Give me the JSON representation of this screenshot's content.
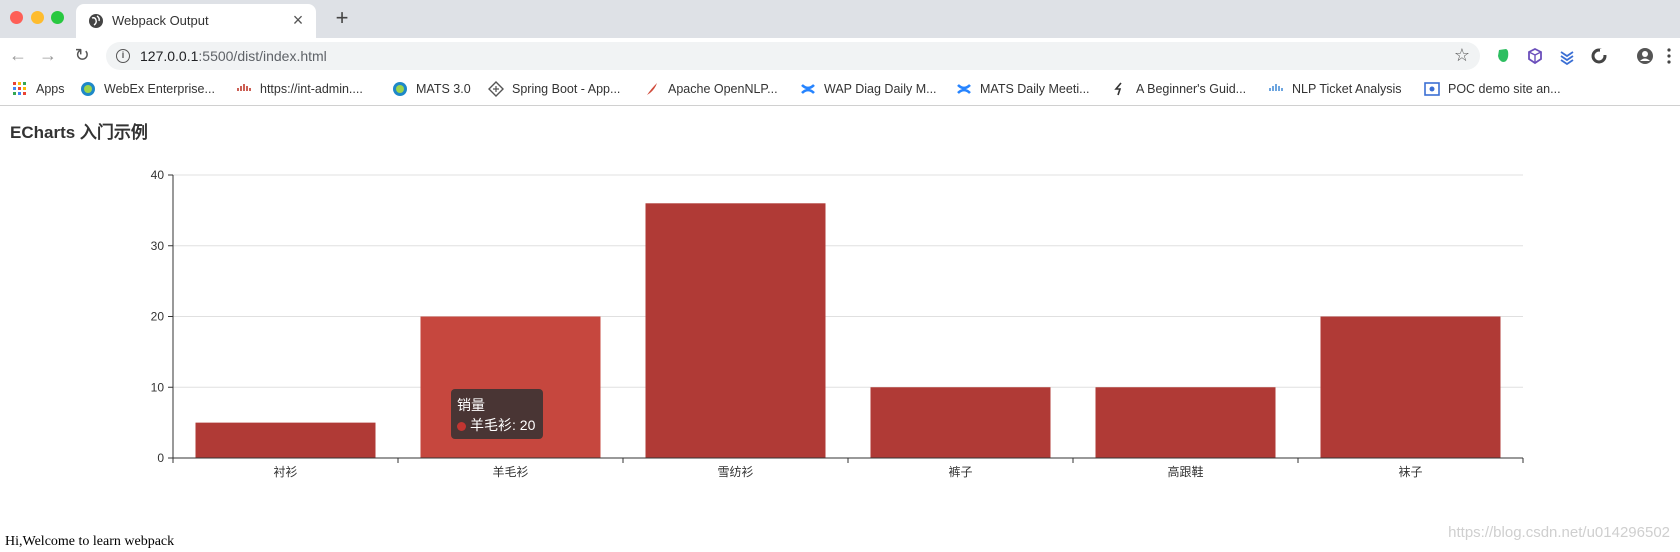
{
  "browser": {
    "tab_title": "Webpack Output",
    "close_glyph": "×",
    "new_tab_glyph": "+",
    "url_host": "127.0.0.1",
    "url_rest": ":5500/dist/index.html",
    "star_glyph": "☆",
    "back_glyph": "←",
    "forward_glyph": "→",
    "reload_glyph": "↻"
  },
  "bookmarks": [
    {
      "label": "Apps",
      "icon": "apps-grid-icon"
    },
    {
      "label": "WebEx Enterprise...",
      "icon": "webex-icon"
    },
    {
      "label": "https://int-admin....",
      "icon": "cisco-icon"
    },
    {
      "label": "MATS 3.0",
      "icon": "mats-icon"
    },
    {
      "label": "Spring Boot - App...",
      "icon": "spring-icon"
    },
    {
      "label": "Apache OpenNLP...",
      "icon": "apache-feather-icon"
    },
    {
      "label": "WAP Diag Daily M...",
      "icon": "confluence-icon"
    },
    {
      "label": "MATS Daily Meeti...",
      "icon": "confluence-icon"
    },
    {
      "label": "A Beginner's Guid...",
      "icon": "link-icon"
    },
    {
      "label": "NLP Ticket Analysis",
      "icon": "cisco-icon"
    },
    {
      "label": "POC demo site an...",
      "icon": "site-icon"
    }
  ],
  "page": {
    "heading": "ECharts 入门示例",
    "welcome": "Hi,Welcome to learn webpack",
    "watermark": "https://blog.csdn.net/u014296502"
  },
  "tooltip": {
    "series_name": "销量",
    "item_text": "羊毛衫: 20"
  },
  "chart_data": {
    "type": "bar",
    "categories": [
      "衬衫",
      "羊毛衫",
      "雪纺衫",
      "裤子",
      "高跟鞋",
      "袜子"
    ],
    "series": [
      {
        "name": "销量",
        "values": [
          5,
          20,
          36,
          10,
          10,
          20
        ]
      }
    ],
    "ylim": [
      0,
      40
    ],
    "yticks": [
      0,
      10,
      20,
      30,
      40
    ],
    "grid": true,
    "highlighted_index": 1,
    "colors": {
      "bar": "#b03a36",
      "bar_highlight": "#c6473e",
      "grid": "#e0e0e0",
      "axis": "#333333"
    }
  }
}
